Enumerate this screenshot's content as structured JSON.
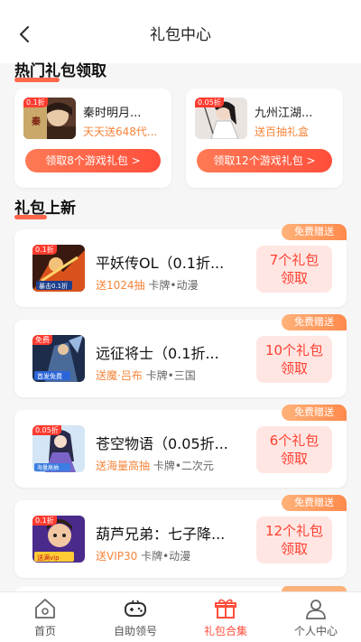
{
  "header": {
    "title": "礼包中心"
  },
  "hot_section": {
    "title": "热门礼包领取",
    "cards": [
      {
        "name": "秦时明月...",
        "subtitle": "天天送648代...",
        "button": "领取8个游戏礼包 >",
        "badge": "0.1折"
      },
      {
        "name": "九州江湖...",
        "subtitle": "送百抽礼盒",
        "button": "领取12个游戏礼包 >",
        "badge": "0.05折"
      }
    ]
  },
  "new_section": {
    "title": "礼包上新",
    "items": [
      {
        "tag": "免费赠送",
        "name": "平妖传OL（0.1折...",
        "highlight": "送1024抽",
        "tags": "卡牌•动漫",
        "claim_line1": "7个礼包",
        "claim_line2": "领取",
        "badge": "0.1折"
      },
      {
        "tag": "免费赠送",
        "name": "远征将士（0.1折...",
        "highlight": "送魔·吕布",
        "tags": "卡牌•三国",
        "claim_line1": "10个礼包",
        "claim_line2": "领取",
        "badge": "免费"
      },
      {
        "tag": "免费赠送",
        "name": "苍空物语（0.05折...",
        "highlight": "送海量高抽",
        "tags": "卡牌•二次元",
        "claim_line1": "6个礼包",
        "claim_line2": "领取",
        "badge": "0.05折"
      },
      {
        "tag": "免费赠送",
        "name": "葫芦兄弟：七子降...",
        "highlight": "送VIP30",
        "tags": "卡牌•动漫",
        "claim_line1": "12个礼包",
        "claim_line2": "领取",
        "badge": "0.1折"
      }
    ]
  },
  "bottom_nav": [
    {
      "label": "首页",
      "icon": "home-icon"
    },
    {
      "label": "自助领号",
      "icon": "gamepad-icon"
    },
    {
      "label": "礼包合集",
      "icon": "gift-icon",
      "active": true
    },
    {
      "label": "个人中心",
      "icon": "user-icon"
    }
  ],
  "colors": {
    "accent": "#ff4e3b",
    "orange": "#f5853b",
    "claim_bg": "#ffe6e3"
  }
}
